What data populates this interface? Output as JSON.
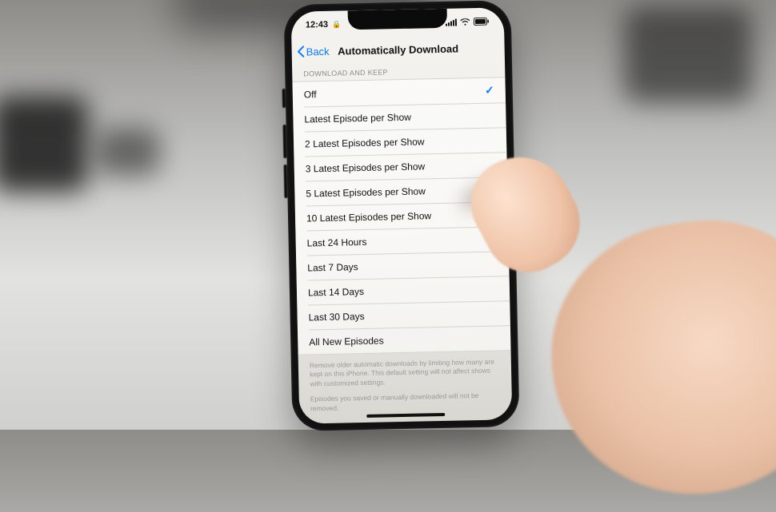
{
  "status": {
    "time": "12:43",
    "lock": "lock-icon"
  },
  "nav": {
    "back_label": "Back",
    "title": "Automatically Download"
  },
  "section": {
    "header": "DOWNLOAD AND KEEP"
  },
  "options": [
    {
      "label": "Off",
      "selected": true
    },
    {
      "label": "Latest Episode per Show",
      "selected": false
    },
    {
      "label": "2 Latest Episodes per Show",
      "selected": false
    },
    {
      "label": "3 Latest Episodes per Show",
      "selected": false
    },
    {
      "label": "5 Latest Episodes per Show",
      "selected": false
    },
    {
      "label": "10 Latest Episodes per Show",
      "selected": false
    },
    {
      "label": "Last 24 Hours",
      "selected": false
    },
    {
      "label": "Last 7 Days",
      "selected": false
    },
    {
      "label": "Last 14 Days",
      "selected": false
    },
    {
      "label": "Last 30 Days",
      "selected": false
    },
    {
      "label": "All New Episodes",
      "selected": false
    }
  ],
  "footer": {
    "note1": "Remove older automatic downloads by limiting how many are kept on this iPhone. This default setting will not affect shows with customized settings.",
    "note2": "Episodes you saved or manually downloaded will not be removed."
  }
}
